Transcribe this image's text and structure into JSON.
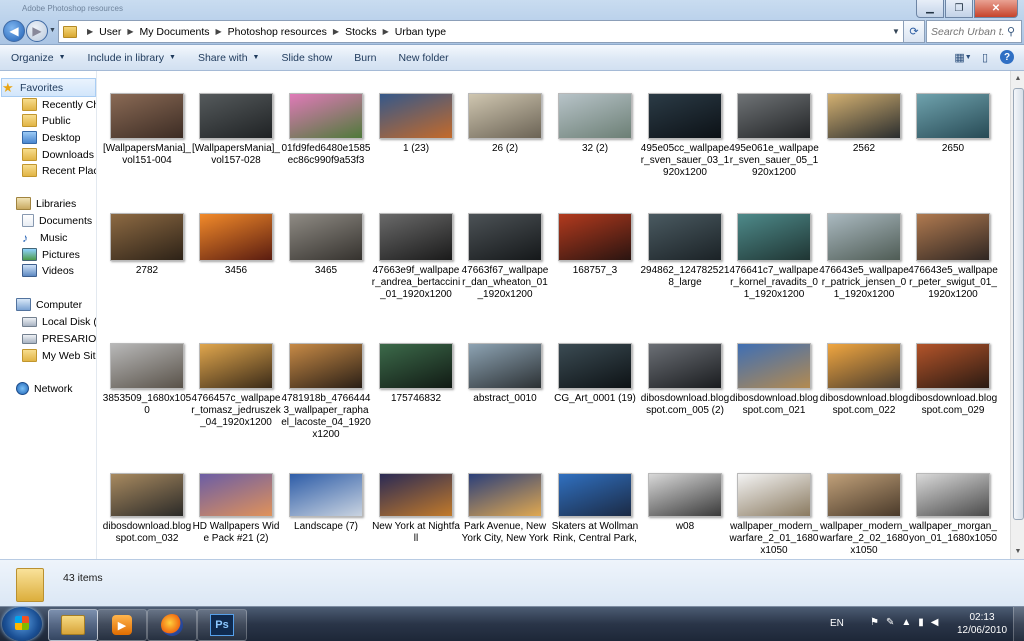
{
  "window": {
    "title_text": "Adobe Photoshop resources"
  },
  "address_bar": {
    "crumbs": [
      "User",
      "My Documents",
      "Photoshop resources",
      "Stocks",
      "Urban type"
    ]
  },
  "search": {
    "placeholder": "Search Urban t..."
  },
  "command_bar": {
    "organize": "Organize",
    "include_in_library": "Include in library",
    "share_with": "Share with",
    "slide_show": "Slide show",
    "burn": "Burn",
    "new_folder": "New folder"
  },
  "nav": {
    "favorites": "Favorites",
    "recently_changed": "Recently Cha",
    "public": "Public",
    "desktop": "Desktop",
    "downloads": "Downloads",
    "recent_places": "Recent Place",
    "libraries": "Libraries",
    "documents": "Documents",
    "music": "Music",
    "pictures": "Pictures",
    "videos": "Videos",
    "computer": "Computer",
    "local_disk": "Local Disk (C",
    "presario": "PRESARIO_RI",
    "my_web_sites": "My Web Site",
    "network": "Network"
  },
  "files": [
    {
      "name": "[WallpapersMania]_vol151-004",
      "colors": [
        "#8a6a55",
        "#3c2c24"
      ]
    },
    {
      "name": "[WallpapersMania]_vol157-028",
      "colors": [
        "#555a5c",
        "#1f2224"
      ]
    },
    {
      "name": "01fd9fed6480e1585ec86c990f9a53f3",
      "colors": [
        "#e07ab8",
        "#4f7a3a"
      ]
    },
    {
      "name": "1 (23)",
      "colors": [
        "#35588a",
        "#c46a2a"
      ]
    },
    {
      "name": "26 (2)",
      "colors": [
        "#cfc6b0",
        "#6b6355"
      ]
    },
    {
      "name": "32 (2)",
      "colors": [
        "#b7c3c8",
        "#6c7f75"
      ]
    },
    {
      "name": "495e05cc_wallpaper_sven_sauer_03_1920x1200",
      "colors": [
        "#2b3b46",
        "#0c1116"
      ]
    },
    {
      "name": "495e061e_wallpaper_sven_sauer_05_1920x1200",
      "colors": [
        "#6f7376",
        "#222426"
      ]
    },
    {
      "name": "2562",
      "colors": [
        "#d3b071",
        "#2a2d2e"
      ]
    },
    {
      "name": "2650",
      "colors": [
        "#6fa2ad",
        "#274a55"
      ]
    },
    {
      "name": "2782",
      "colors": [
        "#8d6a43",
        "#2d2217"
      ]
    },
    {
      "name": "3456",
      "colors": [
        "#f28a2a",
        "#5a1c10"
      ]
    },
    {
      "name": "3465",
      "colors": [
        "#8f8b84",
        "#35322e"
      ]
    },
    {
      "name": "47663e9f_wallpaper_andrea_bertaccini_01_1920x1200",
      "colors": [
        "#6a6a6a",
        "#1a1a1a"
      ]
    },
    {
      "name": "47663f67_wallpaper_dan_wheaton_01_1920x1200",
      "colors": [
        "#4c5256",
        "#15181a"
      ]
    },
    {
      "name": "168757_3",
      "colors": [
        "#b23a1e",
        "#2a1410"
      ]
    },
    {
      "name": "294862_1247825218_large",
      "colors": [
        "#4a5a61",
        "#1b2226"
      ]
    },
    {
      "name": "476641c7_wallpaper_kornel_ravadits_01_1920x1200",
      "colors": [
        "#4e8a8a",
        "#1f3533"
      ]
    },
    {
      "name": "476643e5_wallpaper_patrick_jensen_01_1920x1200",
      "colors": [
        "#aab9c0",
        "#4f5c55"
      ]
    },
    {
      "name": "476643e5_wallpaper_peter_swigut_01_1920x1200",
      "colors": [
        "#b07a50",
        "#2f2622"
      ]
    },
    {
      "name": "3853509_1680x1050",
      "colors": [
        "#b8b8b8",
        "#595249"
      ]
    },
    {
      "name": "4766457c_wallpaper_tomasz_jedruszek_04_1920x1200",
      "colors": [
        "#e0a64d",
        "#3a2a18"
      ]
    },
    {
      "name": "4781918b_47664443_wallpaper_raphael_lacoste_04_1920x1200",
      "colors": [
        "#c78a46",
        "#2a1f16"
      ]
    },
    {
      "name": "175746832",
      "colors": [
        "#3c6a4a",
        "#111a14"
      ]
    },
    {
      "name": "abstract_0010",
      "colors": [
        "#8da3b3",
        "#2c3134"
      ]
    },
    {
      "name": "CG_Art_0001 (19)",
      "colors": [
        "#3b4b53",
        "#0d1215"
      ]
    },
    {
      "name": "dibosdownload.blogspot.com_005 (2)",
      "colors": [
        "#6b6f75",
        "#1a1c1f"
      ]
    },
    {
      "name": "dibosdownload.blogspot.com_021",
      "colors": [
        "#3f6fb4",
        "#b38a50"
      ]
    },
    {
      "name": "dibosdownload.blogspot.com_022",
      "colors": [
        "#f0a640",
        "#4a3c2e"
      ]
    },
    {
      "name": "dibosdownload.blogspot.com_029",
      "colors": [
        "#b3542a",
        "#2a1a12"
      ]
    },
    {
      "name": "dibosdownload.blogspot.com_032",
      "colors": [
        "#a88a60",
        "#2b2a28"
      ]
    },
    {
      "name": "HD Wallpapers Wide Pack #21 (2)",
      "colors": [
        "#6b5da5",
        "#e0925a"
      ]
    },
    {
      "name": "Landscape (7)",
      "colors": [
        "#2e5da8",
        "#c9d3e0"
      ]
    },
    {
      "name": "New York at Nightfall",
      "colors": [
        "#2a2a55",
        "#c27a2a"
      ]
    },
    {
      "name": "Park Avenue, New York City, New York",
      "colors": [
        "#2b3f7a",
        "#e0a850"
      ]
    },
    {
      "name": "Skaters at Wollman Rink, Central Park,",
      "colors": [
        "#3070c0",
        "#1b2a44"
      ]
    },
    {
      "name": "w08",
      "colors": [
        "#d8d8d8",
        "#3a3a3a"
      ]
    },
    {
      "name": "wallpaper_modern_warfare_2_01_1680x1050",
      "colors": [
        "#f3f3f3",
        "#8a7a60"
      ]
    },
    {
      "name": "wallpaper_modern_warfare_2_02_1680x1050",
      "colors": [
        "#c0a079",
        "#4a3a2a"
      ]
    },
    {
      "name": "wallpaper_morgan_yon_01_1680x1050",
      "colors": [
        "#d9d9d9",
        "#4a4a4a"
      ]
    }
  ],
  "details": {
    "item_count": "43 items"
  },
  "taskbar": {
    "language": "EN",
    "time": "02:13",
    "date": "12/06/2010",
    "ps_label": "Ps"
  }
}
